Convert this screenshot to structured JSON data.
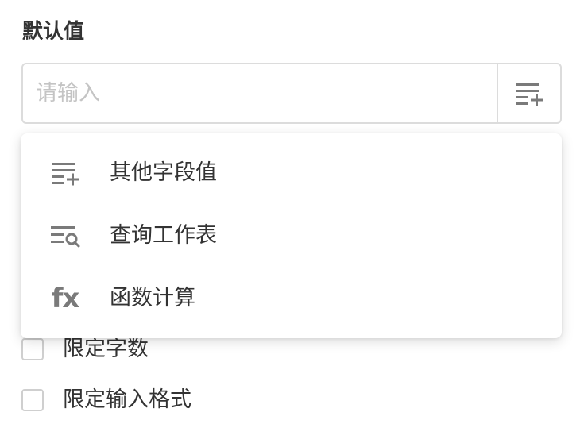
{
  "field": {
    "label": "默认值",
    "placeholder": "请输入",
    "picker_icon": "list-add-icon"
  },
  "dropdown": {
    "items": [
      {
        "label": "其他字段值",
        "icon": "list-add-icon"
      },
      {
        "label": "查询工作表",
        "icon": "list-search-icon"
      },
      {
        "label": "函数计算",
        "icon": "fx-icon",
        "icon_text": "fx"
      }
    ]
  },
  "options": [
    {
      "label": "限定字数",
      "checked": false
    },
    {
      "label": "限定输入格式",
      "checked": false
    }
  ],
  "colors": {
    "icon": "#7a7a7a",
    "border": "#dcdcdc",
    "placeholder": "#c4c4c4",
    "text": "#333333"
  }
}
